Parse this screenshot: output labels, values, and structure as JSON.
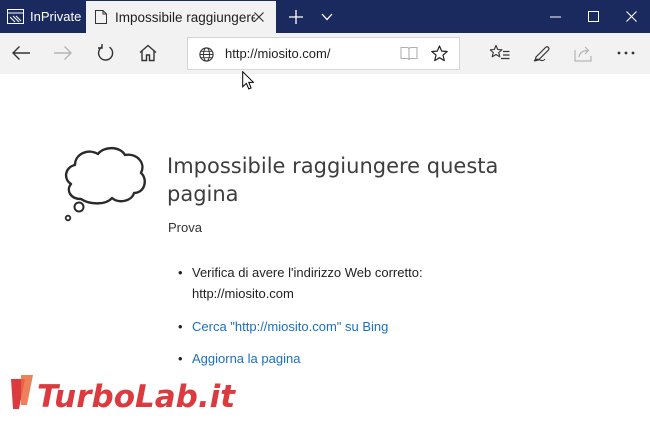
{
  "titlebar": {
    "inprivate_label": "InPrivate",
    "tab_title": "Impossibile raggiungere questa pagina",
    "colors": {
      "titlebar_bg": "#1b2a5e",
      "tab_bg": "#f2f2f2"
    }
  },
  "navbar": {
    "url": "http://miosito.com/",
    "icons": [
      "back-icon",
      "forward-icon",
      "refresh-icon",
      "home-icon",
      "globe-icon",
      "reading-view-icon",
      "favorite-star-icon",
      "hub-icon",
      "web-note-icon",
      "share-icon",
      "more-icon"
    ]
  },
  "page": {
    "title": "Impossibile raggiungere questa pagina",
    "subtitle": "Prova",
    "items": [
      {
        "text": "Verifica di avere l'indirizzo Web corretto: http://miosito.com"
      },
      {
        "text": "Cerca \"http://miosito.com\" su Bing"
      },
      {
        "text": "Aggiorna la pagina"
      }
    ],
    "link_color": "#1a6fc2"
  },
  "watermark": {
    "text": "TurboLab.it"
  }
}
